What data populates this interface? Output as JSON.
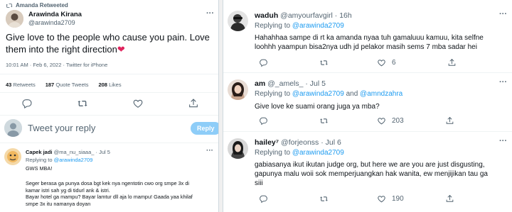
{
  "main_tweet": {
    "retweet_label": "Amanda Retweeted",
    "author_name": "Arawinda Kirana",
    "author_handle": "@arawinda2709",
    "text": "Give love to the people who cause you pain. Love them into the right direction",
    "meta": "10:01 AM · Feb 6, 2022 · Twitter for iPhone",
    "stats": [
      {
        "count": "43",
        "label": "Retweets"
      },
      {
        "count": "187",
        "label": "Quote Tweets"
      },
      {
        "count": "208",
        "label": "Likes"
      }
    ],
    "reply_placeholder": "Tweet your reply",
    "reply_button": "Reply"
  },
  "left_reply": {
    "name": "Capek jadi",
    "handle": "@ma_nu_siaaa_",
    "time": "· Jul 5",
    "replying_prefix": "Replying to",
    "replying_to": "@arawinda2709",
    "lines": [
      "GWS MBA!",
      "",
      "Seger berasa ga punya dosa bgt kek nya ngentotin cwo org smpe 3x di",
      "kamar istri sah yg di tidurl ank & istri.",
      "Bayar hotel ga mampu? Bayar lamtur dll aja lo mampu! Gaada yaa khilaf",
      "smpe 3x itu namanya doyan"
    ]
  },
  "right_replies": [
    {
      "name": "waduh",
      "handle": "@amyourfavgirl",
      "time": "· 16h",
      "replying_prefix": "Replying to",
      "replying_to": "@arawinda2709",
      "replying_extra": "",
      "replying_extra2": "",
      "lines": [
        "Hahahhaa sampe di rt ka amanda nyaa tuh gamaluuu kamuu, kita selfne",
        "loohhh yaampun bisa2nya udh jd pelakor masih sems 7 mba sadar hei"
      ],
      "likes": "6"
    },
    {
      "name": "am",
      "handle": "@_amels_",
      "time": "· Jul 5",
      "replying_prefix": "Replying to",
      "replying_to": "@arawinda2709",
      "replying_extra": "and",
      "replying_extra2": "@amndzahra",
      "lines": [
        "Give love ke suami orang juga ya mba?"
      ],
      "likes": "203"
    },
    {
      "name": "hailey⁷",
      "handle": "@forjeonss",
      "time": "· Jul 6",
      "replying_prefix": "Replying to",
      "replying_to": "@arawinda2709",
      "replying_extra": "",
      "replying_extra2": "",
      "lines": [
        "gabiasanya ikut ikutan judge org, but here we are you are just disgusting,",
        "gapunya malu woii sok memperjuangkan hak wanita, ew menjijikan tau ga",
        "siii"
      ],
      "likes": "190"
    }
  ],
  "colors": {
    "accent": "#1d9bf0",
    "heart": "#e0245e",
    "muted": "#536471"
  }
}
